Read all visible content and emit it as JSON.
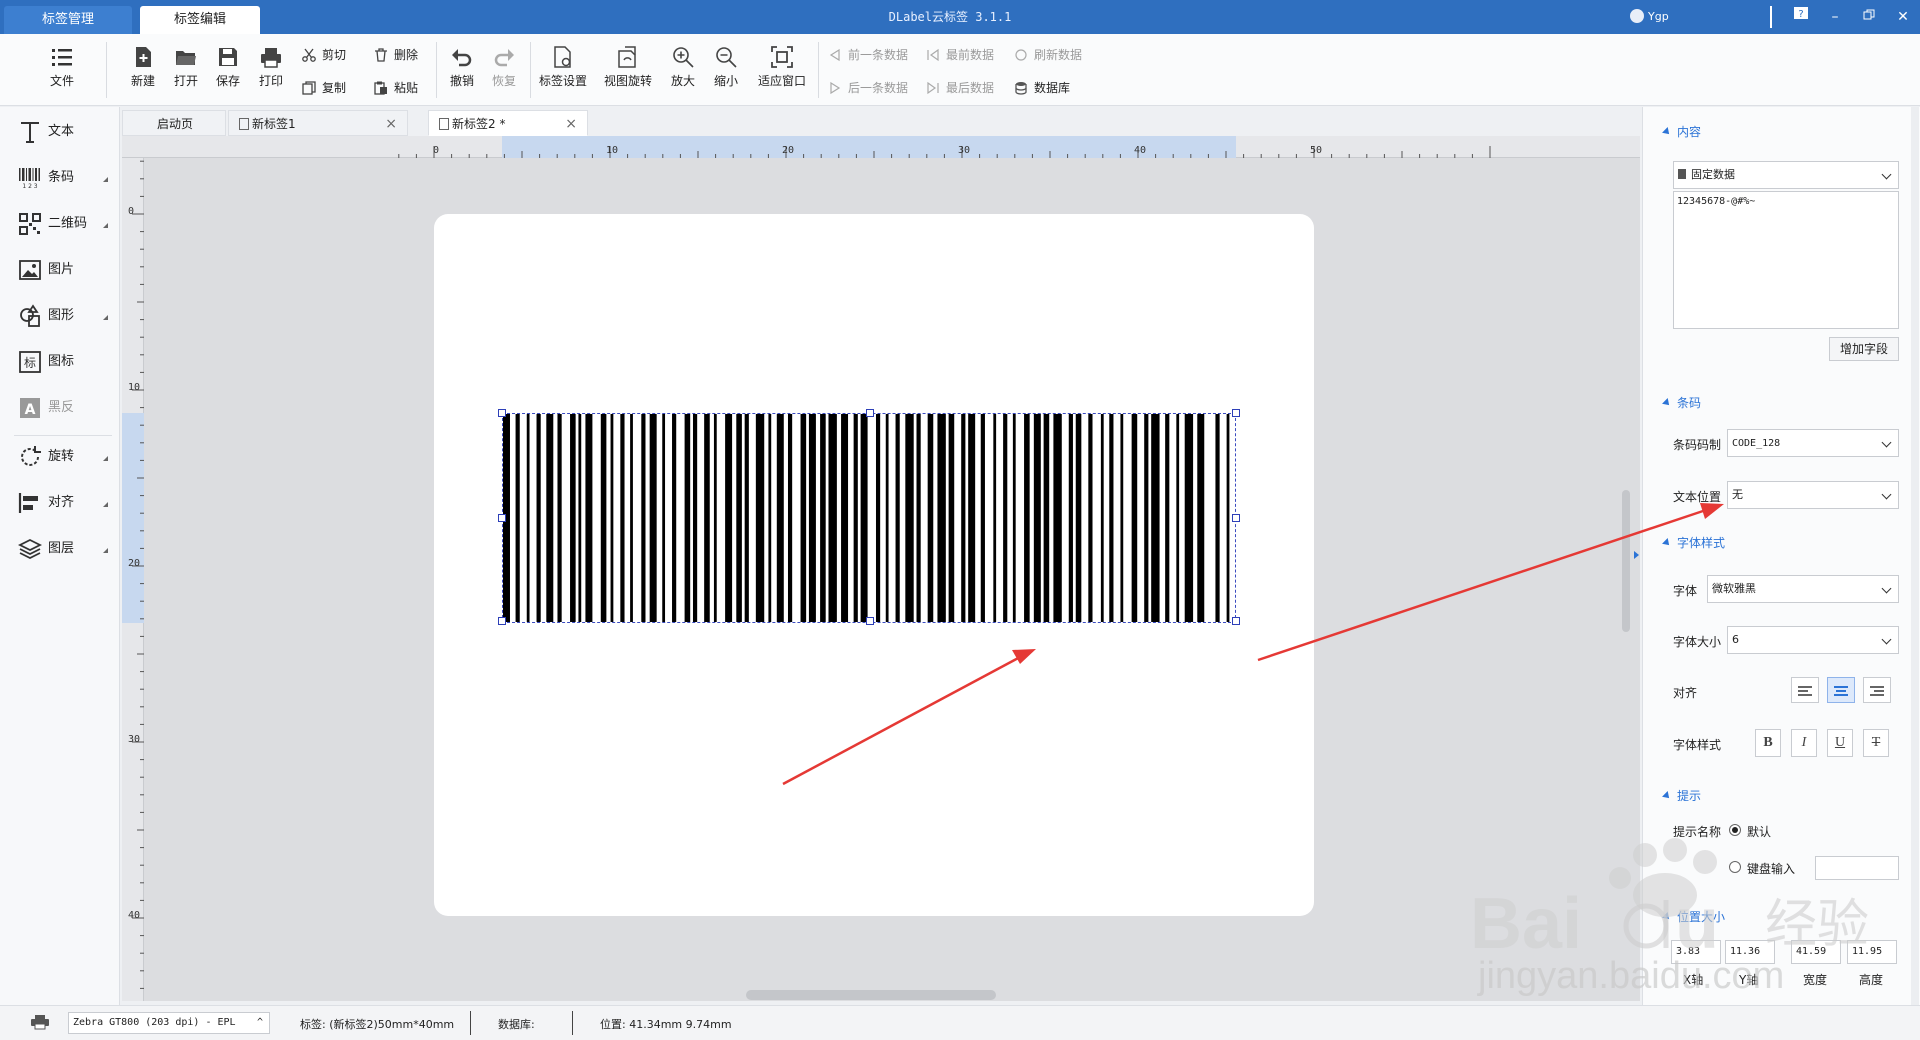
{
  "titlebar": {
    "tabs": [
      {
        "label": "标签管理"
      },
      {
        "label": "标签编辑"
      }
    ],
    "app_title": "DLabel云标签 3.1.1",
    "user": "Ygp"
  },
  "toolbar": {
    "file": "文件",
    "new": "新建",
    "open": "打开",
    "save": "保存",
    "print": "打印",
    "cut": "剪切",
    "copy": "复制",
    "delete": "删除",
    "paste": "粘贴",
    "undo": "撤销",
    "redo": "恢复",
    "label_settings": "标签设置",
    "view_rotate": "视图旋转",
    "zoom_in": "放大",
    "zoom_out": "缩小",
    "fit_window": "适应窗口",
    "prev_record": "前一条数据",
    "next_record": "后一条数据",
    "first_record": "最前数据",
    "last_record": "最后数据",
    "refresh_data": "刷新数据",
    "database": "数据库"
  },
  "sidebar": {
    "items": [
      {
        "label": "文本"
      },
      {
        "label": "条码"
      },
      {
        "label": "二维码"
      },
      {
        "label": "图片"
      },
      {
        "label": "图形"
      },
      {
        "label": "图标"
      },
      {
        "label": "黑反"
      },
      {
        "label": "旋转"
      },
      {
        "label": "对齐"
      },
      {
        "label": "图层"
      }
    ]
  },
  "doc_tabs": [
    {
      "label": "启动页"
    },
    {
      "label": "新标签1"
    },
    {
      "label": "新标签2 *"
    }
  ],
  "ruler": {
    "h_labels": [
      "0",
      "10",
      "20",
      "30",
      "40",
      "50"
    ],
    "v_labels": [
      "0",
      "10",
      "20",
      "30",
      "40"
    ]
  },
  "barcode": {
    "symbology": "CODE_128",
    "bar_widths": [
      5,
      4,
      3,
      5,
      2,
      5,
      3,
      4,
      5,
      3,
      3,
      6,
      4,
      2,
      2,
      3,
      5,
      6,
      4,
      3,
      2,
      5,
      3,
      4,
      2,
      6,
      3,
      3,
      5,
      4,
      2,
      5,
      3,
      6,
      4,
      2,
      3,
      5,
      4,
      3,
      2,
      6,
      5,
      3,
      4,
      2,
      3,
      5,
      6,
      3,
      2,
      4,
      5,
      3,
      3,
      6,
      4,
      2,
      5,
      3,
      4,
      2,
      6,
      3,
      5,
      4,
      3,
      2,
      5,
      6,
      3,
      4,
      2,
      5,
      3,
      4,
      6,
      2,
      3,
      5,
      4,
      3,
      6,
      2,
      4,
      5,
      3,
      2,
      5,
      4,
      3,
      6,
      2,
      5,
      3,
      4,
      2,
      6,
      4,
      3,
      5,
      2,
      4,
      3,
      6,
      5,
      3,
      2,
      4,
      5,
      3,
      6,
      2,
      4,
      3,
      5,
      2,
      6,
      4,
      5,
      3,
      2,
      6,
      4,
      3,
      5,
      2,
      4,
      6,
      3,
      5,
      8,
      3,
      5,
      2,
      4
    ]
  },
  "right_panel": {
    "content_title": "内容",
    "data_source": "固定数据",
    "content_value": "12345678-@#%~",
    "add_field_button": "增加字段",
    "barcode_title": "条码",
    "symbology_label": "条码码制",
    "symbology_value": "CODE_128",
    "text_pos_label": "文本位置",
    "text_pos_value": "无",
    "font_title": "字体样式",
    "font_label": "字体",
    "font_value": "微软雅黑",
    "font_size_label": "字体大小",
    "font_size_value": "6",
    "align_label": "对齐",
    "font_style_label": "字体样式",
    "style_bold": "B",
    "style_italic": "I",
    "style_underline": "U",
    "style_strike": "T",
    "tip_title": "提示",
    "tip_name_label": "提示名称",
    "tip_default": "默认",
    "tip_keyboard": "键盘输入",
    "pos_title": "位置大小",
    "pos_values": [
      "3.83",
      "11.36",
      "41.59",
      "11.95"
    ],
    "pos_labels": [
      "X轴",
      "Y轴",
      "宽度",
      "高度"
    ]
  },
  "statusbar": {
    "printer": "Zebra GT800 (203 dpi) - EPL",
    "label_info": "标签: (新标签2)50mm*40mm",
    "database_info": "数据库:",
    "position_info": "位置: 41.34mm 9.74mm"
  },
  "watermark": "jingyan.baidu.com",
  "colors": {
    "titlebar": "#2f6fbf",
    "accent": "#2b73d6",
    "annotation_arrow": "#e53935"
  }
}
